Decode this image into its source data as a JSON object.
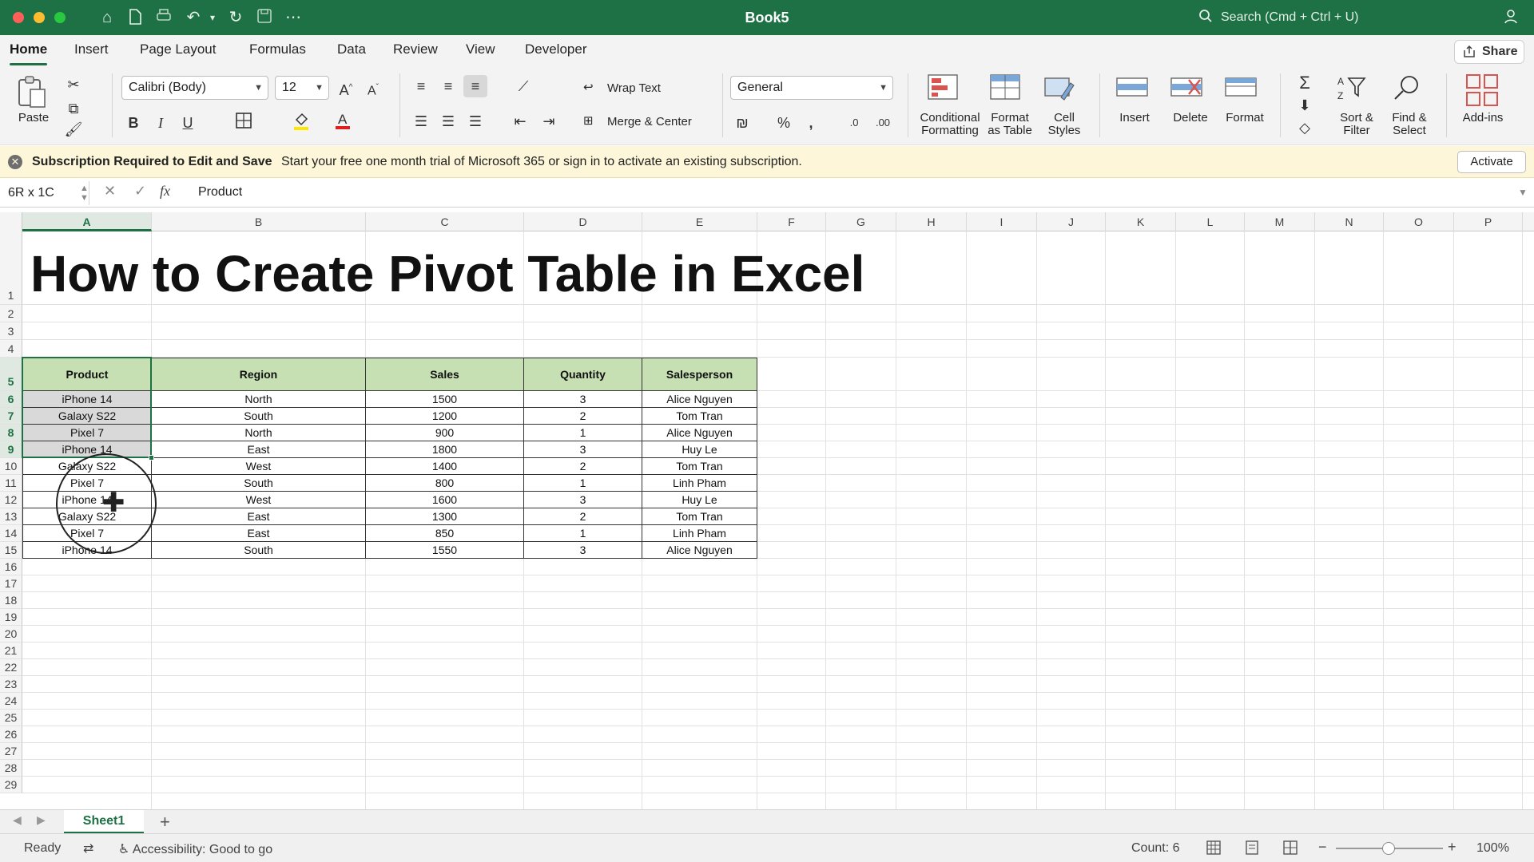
{
  "window": {
    "title": "Book5",
    "search_placeholder": "Search (Cmd + Ctrl + U)"
  },
  "tabs": [
    "Home",
    "Insert",
    "Page Layout",
    "Formulas",
    "Data",
    "Review",
    "View",
    "Developer"
  ],
  "active_tab": "Home",
  "share_label": "Share",
  "ribbon": {
    "paste": "Paste",
    "font_name": "Calibri (Body)",
    "font_size": "12",
    "wrap_text": "Wrap Text",
    "merge_center": "Merge & Center",
    "number_format": "General",
    "conditional_formatting": [
      "Conditional",
      "Formatting"
    ],
    "format_as_table": [
      "Format",
      "as Table"
    ],
    "cell_styles": [
      "Cell",
      "Styles"
    ],
    "insert": "Insert",
    "delete": "Delete",
    "format": "Format",
    "sort_filter": [
      "Sort &",
      "Filter"
    ],
    "find_select": [
      "Find &",
      "Select"
    ],
    "add_ins": "Add-ins"
  },
  "notification": {
    "title": "Subscription Required to Edit and Save",
    "message": "Start your free one month trial of Microsoft 365 or sign in to activate an existing subscription.",
    "button": "Activate"
  },
  "formula_bar": {
    "name_box": "6R x 1C",
    "formula": "Product"
  },
  "columns": [
    "A",
    "B",
    "C",
    "D",
    "E",
    "F",
    "G",
    "H",
    "I",
    "J",
    "K",
    "L",
    "M",
    "N",
    "O",
    "P"
  ],
  "rows": [
    "1",
    "2",
    "3",
    "4",
    "5",
    "6",
    "7",
    "8",
    "9",
    "10",
    "11",
    "12",
    "13",
    "14",
    "15",
    "16",
    "17",
    "18",
    "19",
    "20",
    "21",
    "22",
    "23",
    "24",
    "25",
    "26",
    "27",
    "28",
    "29"
  ],
  "sheet_title": "How to Create Pivot Table in Excel",
  "table": {
    "headers": [
      "Product",
      "Region",
      "Sales",
      "Quantity",
      "Salesperson"
    ],
    "rows": [
      [
        "iPhone 14",
        "North",
        "1500",
        "3",
        "Alice Nguyen"
      ],
      [
        "Galaxy S22",
        "South",
        "1200",
        "2",
        "Tom Tran"
      ],
      [
        "Pixel 7",
        "North",
        "900",
        "1",
        "Alice Nguyen"
      ],
      [
        "iPhone 14",
        "East",
        "1800",
        "3",
        "Huy Le"
      ],
      [
        "Galaxy S22",
        "West",
        "1400",
        "2",
        "Tom Tran"
      ],
      [
        "Pixel 7",
        "South",
        "800",
        "1",
        "Linh Pham"
      ],
      [
        "iPhone 14",
        "West",
        "1600",
        "3",
        "Huy Le"
      ],
      [
        "Galaxy S22",
        "East",
        "1300",
        "2",
        "Tom Tran"
      ],
      [
        "Pixel 7",
        "East",
        "850",
        "1",
        "Linh Pham"
      ],
      [
        "iPhone 14",
        "South",
        "1550",
        "3",
        "Alice Nguyen"
      ]
    ]
  },
  "sheet_tabs": [
    "Sheet1"
  ],
  "status": {
    "ready": "Ready",
    "accessibility": "Accessibility: Good to go",
    "count": "Count: 6",
    "zoom": "100%"
  }
}
